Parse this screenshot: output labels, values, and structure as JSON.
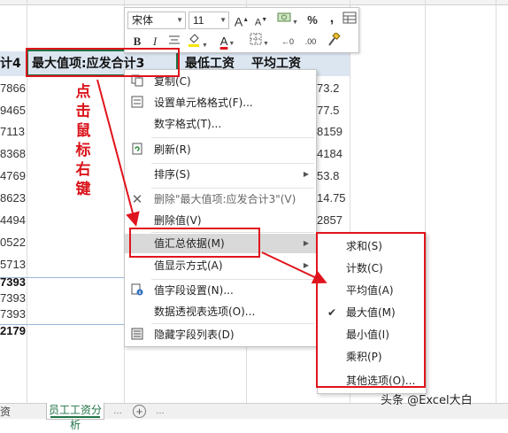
{
  "sheet": {
    "headers": [
      "计4",
      "最大值项:应发合计3",
      "最低工资",
      "平均工资"
    ],
    "left_values": [
      "7866",
      "9465",
      "7113",
      "8368",
      "4769",
      "8623",
      "4494",
      "0522",
      "5713",
      "7393",
      "7393",
      "7393",
      "2179"
    ],
    "right_values": [
      "73.2",
      "77.5",
      "8159",
      "4184",
      "53.8",
      "14.75",
      "2857"
    ]
  },
  "mini_toolbar": {
    "font_name": "宋体",
    "font_size": "11",
    "buttons": {
      "grow_font": "A",
      "shrink_font": "A",
      "accounting": "$",
      "percent": "%",
      "comma": ",",
      "bold": "B",
      "italic": "I",
      "font_color": "A",
      "inc_decimal": "←0",
      "dec_decimal": ".00"
    }
  },
  "context_menu": {
    "items": [
      {
        "label": "复制(C)",
        "icon": "copy-icon"
      },
      {
        "label": "设置单元格格式(F)...",
        "icon": "format-cells-icon"
      },
      {
        "label": "数字格式(T)...",
        "icon": ""
      },
      {
        "label": "刷新(R)",
        "icon": "refresh-icon"
      },
      {
        "label": "排序(S)",
        "icon": "",
        "submenu": true
      },
      {
        "label": "删除\"最大值项:应发合计3\"(V)",
        "icon": "delete-icon"
      },
      {
        "label": "删除值(V)",
        "icon": ""
      },
      {
        "label": "值汇总依据(M)",
        "icon": "",
        "submenu": true,
        "highlighted": true
      },
      {
        "label": "值显示方式(A)",
        "icon": "",
        "submenu": true
      },
      {
        "label": "值字段设置(N)...",
        "icon": "field-settings-icon"
      },
      {
        "label": "数据透视表选项(O)...",
        "icon": ""
      },
      {
        "label": "隐藏字段列表(D)",
        "icon": "field-list-icon"
      }
    ]
  },
  "submenu": {
    "items": [
      {
        "label": "求和(S)",
        "checked": false
      },
      {
        "label": "计数(C)",
        "checked": false
      },
      {
        "label": "平均值(A)",
        "checked": false
      },
      {
        "label": "最大值(M)",
        "checked": true
      },
      {
        "label": "最小值(I)",
        "checked": false
      },
      {
        "label": "乘积(P)",
        "checked": false
      },
      {
        "label": "其他选项(O)...",
        "checked": false
      }
    ]
  },
  "annotation": {
    "text": [
      "点",
      "击",
      "鼠",
      "标",
      "右",
      "键"
    ],
    "color": "#d9131a"
  },
  "tabs": {
    "left": "资",
    "active": "员工工资分析",
    "add": "+"
  },
  "watermark": "头条 @Excel大白",
  "colors": {
    "accent_green": "#1f7244",
    "pivot_header": "#dce6f1",
    "annotation_red": "#e0141c",
    "menu_highlight": "#d9d9d9"
  }
}
